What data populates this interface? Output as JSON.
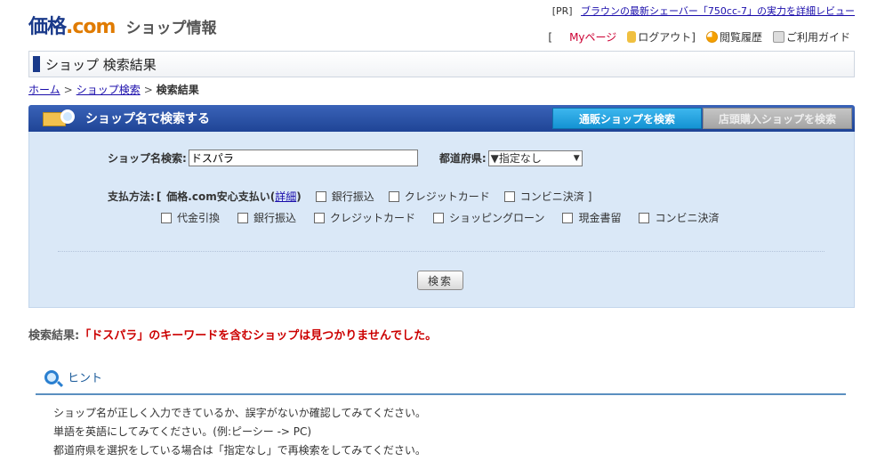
{
  "header": {
    "logo_main": "価格",
    "logo_com": ".com",
    "logo_sub": "ショップ情報",
    "pr_tag": "[PR]",
    "pr_link": "ブラウンの最新シェーバー「750cc-7」の実力を詳細レビュー",
    "util_open": "[",
    "util_nav": {
      "mypage": "Myページ",
      "logout": "ログアウト]",
      "history": "閲覧履歴",
      "guide": "ご利用ガイド"
    }
  },
  "page_title": "ショップ 検索結果",
  "breadcrumb": {
    "home": "ホーム",
    "sep": ">",
    "shop_search": "ショップ検索",
    "current": "検索結果"
  },
  "search": {
    "title": "ショップ名で検索する",
    "tab_online": "通販ショップを検索",
    "tab_store": "店頭購入ショップを検索",
    "shop_name_label": "ショップ名検索:",
    "shop_name_value": "ドスパラ",
    "pref_label": "都道府県:",
    "pref_value": "▼指定なし",
    "payment_label": "支払方法:",
    "payment_open": "[",
    "safe_pay_label": "価格.com安心支払い",
    "safe_pay_open": "(",
    "safe_pay_detail": "詳細",
    "safe_pay_close": ")",
    "safe_options": [
      "銀行振込",
      "クレジットカード",
      "コンビニ決済"
    ],
    "payment_close": "]",
    "other_options": [
      "代金引換",
      "銀行振込",
      "クレジットカード",
      "ショッピングローン",
      "現金書留",
      "コンビニ決済"
    ],
    "submit_label": "検索"
  },
  "result": {
    "prefix": "検索結果:",
    "message": "「ドスパラ」のキーワードを含むショップは見つかりませんでした。"
  },
  "hint": {
    "title": "ヒント",
    "items": [
      "ショップ名が正しく入力できているか、誤字がないか確認してみてください。",
      "単語を英語にしてみてください。(例:ピーシー -> PC)",
      "都道府県を選択をしている場合は「指定なし」で再検索をしてみてください。"
    ]
  },
  "colors": {
    "brand_blue": "#1a3a8a",
    "brand_orange": "#e07b00",
    "header_blue": "#1f4496",
    "tab_active": "#1493d3",
    "panel_bg": "#dae8f7",
    "error_red": "#cc0000"
  }
}
